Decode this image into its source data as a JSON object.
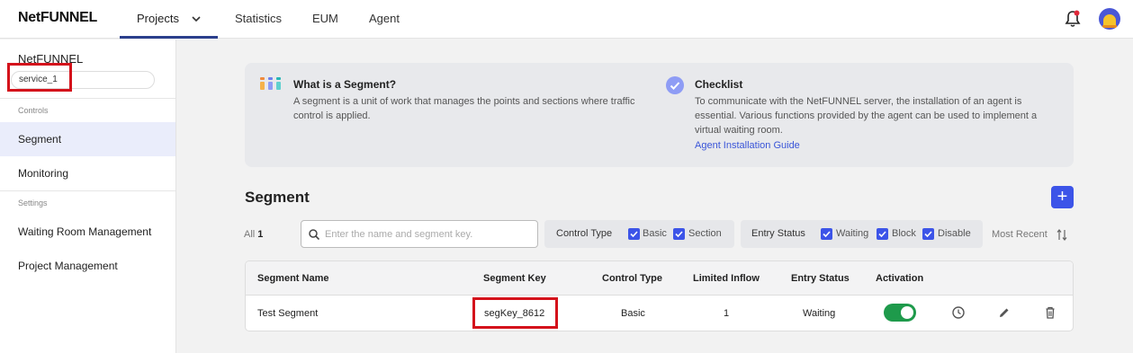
{
  "app": {
    "logo": "NetFUNNEL"
  },
  "nav": {
    "tabs": [
      {
        "label": "Projects"
      },
      {
        "label": "Statistics"
      },
      {
        "label": "EUM"
      },
      {
        "label": "Agent"
      }
    ]
  },
  "sidebar": {
    "title": "NetFUNNEL",
    "project_select": "service_1",
    "sections": [
      {
        "label": "Controls",
        "items": [
          "Segment",
          "Monitoring"
        ]
      },
      {
        "label": "Settings",
        "items": [
          "Waiting Room Management",
          "Project Management"
        ]
      }
    ]
  },
  "info": {
    "segment_title": "What is a Segment?",
    "segment_text_1": "A segment is a unit of work that manages the points and sections where traffic",
    "segment_text_2": "control is applied.",
    "checklist_title": "Checklist",
    "checklist_text_1": "To communicate with the NetFUNNEL server, the installation of an agent is",
    "checklist_text_2": "essential. Various functions provided by the agent can be used to implement a",
    "checklist_text_3": "virtual waiting room.",
    "checklist_link": "Agent Installation Guide"
  },
  "segment": {
    "title": "Segment",
    "add_label": "+",
    "all_label": "All",
    "all_count": "1",
    "search_placeholder": "Enter the name and segment key.",
    "control_type": {
      "label": "Control Type",
      "options": [
        "Basic",
        "Section"
      ]
    },
    "entry_status": {
      "label": "Entry Status",
      "options": [
        "Waiting",
        "Block",
        "Disable"
      ]
    },
    "sort_label": "Most Recent",
    "columns": [
      "Segment Name",
      "Segment Key",
      "Control Type",
      "Limited Inflow",
      "Entry Status",
      "Activation"
    ],
    "rows": [
      {
        "name": "Test Segment",
        "key": "segKey_8612",
        "control_type": "Basic",
        "limited_inflow": "1",
        "entry_status": "Waiting",
        "activation": true
      }
    ]
  },
  "colors": {
    "accent": "#3c54e8",
    "toggle_on": "#1e9a4b",
    "highlight": "#d4121b"
  }
}
